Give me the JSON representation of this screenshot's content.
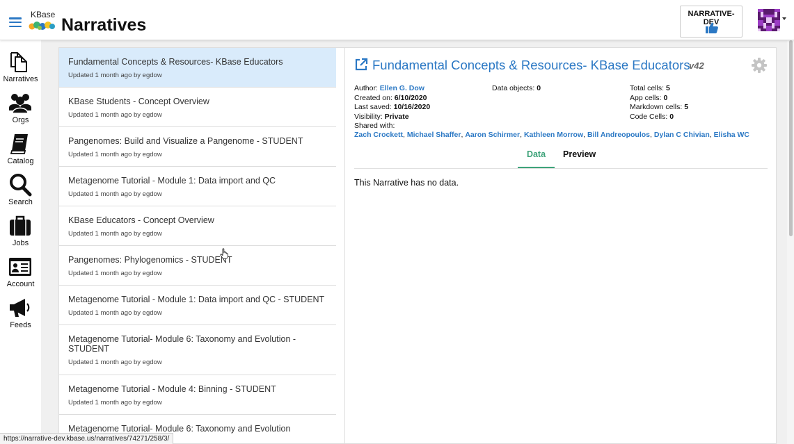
{
  "header": {
    "logo_text": "KBase",
    "title": "Narratives",
    "env_label": "NARRATIVE-DEV",
    "env_icon": "thumbs-up-icon",
    "accent_color": "#2b78c4"
  },
  "sidebar": {
    "items": [
      {
        "label": "Narratives",
        "icon": "narratives-icon"
      },
      {
        "label": "Orgs",
        "icon": "orgs-icon"
      },
      {
        "label": "Catalog",
        "icon": "catalog-icon"
      },
      {
        "label": "Search",
        "icon": "search-icon"
      },
      {
        "label": "Jobs",
        "icon": "jobs-icon"
      },
      {
        "label": "Account",
        "icon": "account-icon"
      },
      {
        "label": "Feeds",
        "icon": "feeds-icon"
      }
    ]
  },
  "narratives": {
    "items": [
      {
        "title": "Fundamental Concepts & Resources- KBase Educators",
        "updated": "Updated 1 month ago by egdow",
        "selected": true
      },
      {
        "title": "KBase Students - Concept Overview",
        "updated": "Updated 1 month ago by egdow"
      },
      {
        "title": "Pangenomes: Build and Visualize a Pangenome - STUDENT",
        "updated": "Updated 1 month ago by egdow"
      },
      {
        "title": "Metagenome Tutorial - Module 1: Data import and QC",
        "updated": "Updated 1 month ago by egdow"
      },
      {
        "title": "KBase Educators - Concept Overview",
        "updated": "Updated 1 month ago by egdow"
      },
      {
        "title": "Pangenomes: Phylogenomics - STUDENT",
        "updated": "Updated 1 month ago by egdow"
      },
      {
        "title": "Metagenome Tutorial - Module 1: Data import and QC - STUDENT",
        "updated": "Updated 1 month ago by egdow"
      },
      {
        "title": "Metagenome Tutorial- Module 6: Taxonomy and Evolution - STUDENT",
        "updated": "Updated 1 month ago by egdow"
      },
      {
        "title": "Metagenome Tutorial - Module 4: Binning - STUDENT",
        "updated": "Updated 1 month ago by egdow"
      },
      {
        "title": "Metagenome Tutorial- Module 6: Taxonomy and Evolution",
        "updated": ""
      }
    ]
  },
  "detail": {
    "title": "Fundamental Concepts & Resources- KBase Educators",
    "version": "v42",
    "author_label": "Author:",
    "author": "Ellen G. Dow",
    "created_label": "Created on:",
    "created": "6/10/2020",
    "saved_label": "Last saved:",
    "saved": "10/16/2020",
    "visibility_label": "Visibility:",
    "visibility": "Private",
    "shared_label": "Shared with:",
    "shared_with": [
      "Zach Crockett",
      "Michael Shaffer",
      "Aaron Schirmer",
      "Kathleen Morrow",
      "Bill Andreopoulos",
      "Dylan C Chivian",
      "Elisha WC"
    ],
    "data_objects_label": "Data objects:",
    "data_objects": "0",
    "total_cells_label": "Total cells:",
    "total_cells": "5",
    "app_cells_label": "App cells:",
    "app_cells": "0",
    "markdown_cells_label": "Markdown cells:",
    "markdown_cells": "5",
    "code_cells_label": "Code Cells:",
    "code_cells": "0",
    "tabs": [
      "Data",
      "Preview"
    ],
    "active_tab": "Data",
    "empty_message": "This Narrative has no data."
  },
  "status_bar": {
    "url": "https://narrative-dev.kbase.us/narratives/74271/258/3/"
  }
}
